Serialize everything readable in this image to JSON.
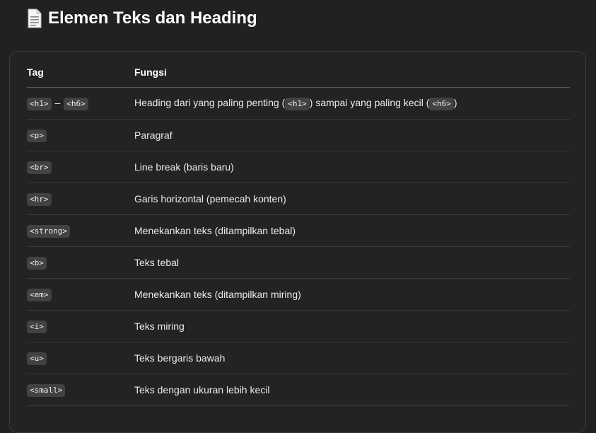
{
  "page": {
    "title": "Elemen Teks dan Heading",
    "title_icon": "document-icon"
  },
  "table": {
    "headers": {
      "tag": "Tag",
      "fungsi": "Fungsi"
    },
    "row0": {
      "tag_a": "<h1>",
      "sep": "–",
      "tag_b": "<h6>",
      "desc_1": "Heading dari yang paling penting (",
      "code_1": "<h1>",
      "desc_2": ") sampai yang paling kecil (",
      "code_2": "<h6>",
      "desc_3": ")"
    },
    "rows": [
      {
        "tag": "<p>",
        "desc": "Paragraf"
      },
      {
        "tag": "<br>",
        "desc": "Line break (baris baru)"
      },
      {
        "tag": "<hr>",
        "desc": "Garis horizontal (pemecah konten)"
      },
      {
        "tag": "<strong>",
        "desc": "Menekankan teks (ditampilkan tebal)"
      },
      {
        "tag": "<b>",
        "desc": "Teks tebal"
      },
      {
        "tag": "<em>",
        "desc": "Menekankan teks (ditampilkan miring)"
      },
      {
        "tag": "<i>",
        "desc": "Teks miring"
      },
      {
        "tag": "<u>",
        "desc": "Teks bergaris bawah"
      },
      {
        "tag": "<small>",
        "desc": "Teks dengan ukuran lebih kecil"
      }
    ]
  },
  "colors": {
    "background": "#212121",
    "code_background": "#424242",
    "border": "#3a3a3a"
  }
}
